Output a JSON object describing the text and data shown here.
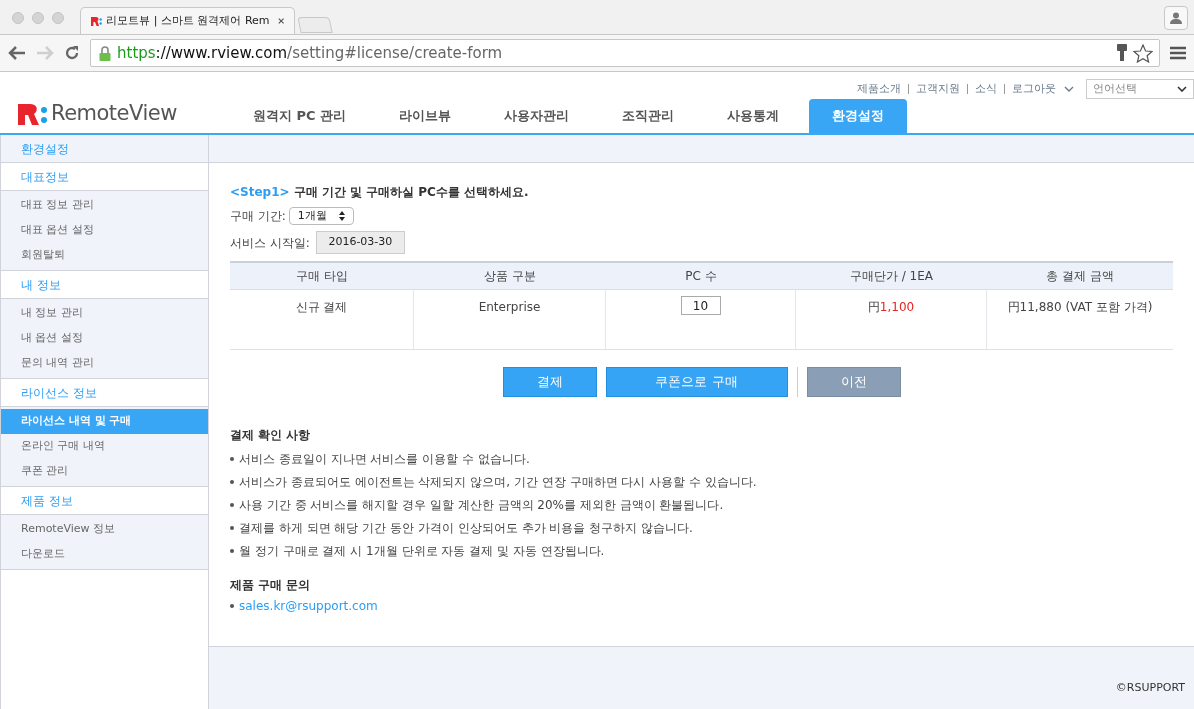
{
  "browser": {
    "tab_title": "리모트뷰 | 스마트 원격제어 Rem",
    "url": {
      "scheme": "https",
      "host": "://www.rview.com",
      "path": "/setting#license/create-form"
    },
    "forward_disabled": true
  },
  "header": {
    "logo_text": "RemoteView",
    "top_links": [
      "제품소개",
      "고객지원",
      "소식",
      "로그아웃"
    ],
    "language_select": {
      "value": "언어선택"
    },
    "nav": [
      {
        "label": "원격지 PC 관리",
        "selected": false
      },
      {
        "label": "라이브뷰",
        "selected": false
      },
      {
        "label": "사용자관리",
        "selected": false
      },
      {
        "label": "조직관리",
        "selected": false
      },
      {
        "label": "사용통계",
        "selected": false
      },
      {
        "label": "환경설정",
        "selected": true
      }
    ]
  },
  "sidebar": {
    "title": "환경설정",
    "groups": [
      {
        "label": "대표정보",
        "items": [
          {
            "label": "대표 정보 관리",
            "selected": false
          },
          {
            "label": "대표 옵션 설정",
            "selected": false
          },
          {
            "label": "회원탈퇴",
            "selected": false
          }
        ]
      },
      {
        "label": "내 정보",
        "items": [
          {
            "label": "내 정보 관리",
            "selected": false
          },
          {
            "label": "내 옵션 설정",
            "selected": false
          },
          {
            "label": "문의 내역 관리",
            "selected": false
          }
        ]
      },
      {
        "label": "라이선스 정보",
        "items": [
          {
            "label": "라이선스 내역 및 구매",
            "selected": true
          },
          {
            "label": "온라인 구매 내역",
            "selected": false
          },
          {
            "label": "쿠폰 관리",
            "selected": false
          }
        ]
      },
      {
        "label": "제품 정보",
        "items": [
          {
            "label": "RemoteView 정보",
            "selected": false
          },
          {
            "label": "다운로드",
            "selected": false
          }
        ]
      }
    ]
  },
  "form": {
    "step_label": "<Step1>",
    "step_text": "구매 기간 및 구매하실 PC수를 선택하세요.",
    "period_label": "구매 기간:",
    "period_value": "1개월",
    "start_label": "서비스 시작일:",
    "start_value": "2016-03-30",
    "table": {
      "columns": [
        "구매 타입",
        "상품 구분",
        "PC 수",
        "구매단가 / 1EA",
        "총 결제 금액"
      ],
      "row": {
        "type": "신규 결제",
        "product": "Enterprise",
        "pc_count": "10",
        "unit_currency": "円",
        "unit_amount": "1,100",
        "total": "円11,880 (VAT 포함 가격)"
      }
    },
    "buttons": [
      {
        "label": "결제",
        "kind": "primary"
      },
      {
        "label": "쿠폰으로 구매",
        "kind": "primary"
      },
      {
        "label": "이전",
        "kind": "secondary"
      }
    ]
  },
  "notes": {
    "title": "결제 확인 사항",
    "items": [
      "서비스 종료일이 지나면 서비스를 이용할 수 없습니다.",
      "서비스가 종료되어도 에이전트는 삭제되지 않으며, 기간 연장 구매하면 다시 사용할 수 있습니다.",
      "사용 기간 중 서비스를 해지할 경우 일할 계산한 금액의 20%를 제외한 금액이 환불됩니다.",
      "결제를 하게 되면 해당 기간 동안 가격이 인상되어도 추가 비용을 청구하지 않습니다.",
      "월 정기 구매로 결제 시 1개월 단위로 자동 결제 및 자동 연장됩니다."
    ]
  },
  "contact": {
    "title": "제품 구매 문의",
    "email": "sales.kr@rsupport.com"
  },
  "footer": {
    "copyright": "©RSUPPORT"
  }
}
